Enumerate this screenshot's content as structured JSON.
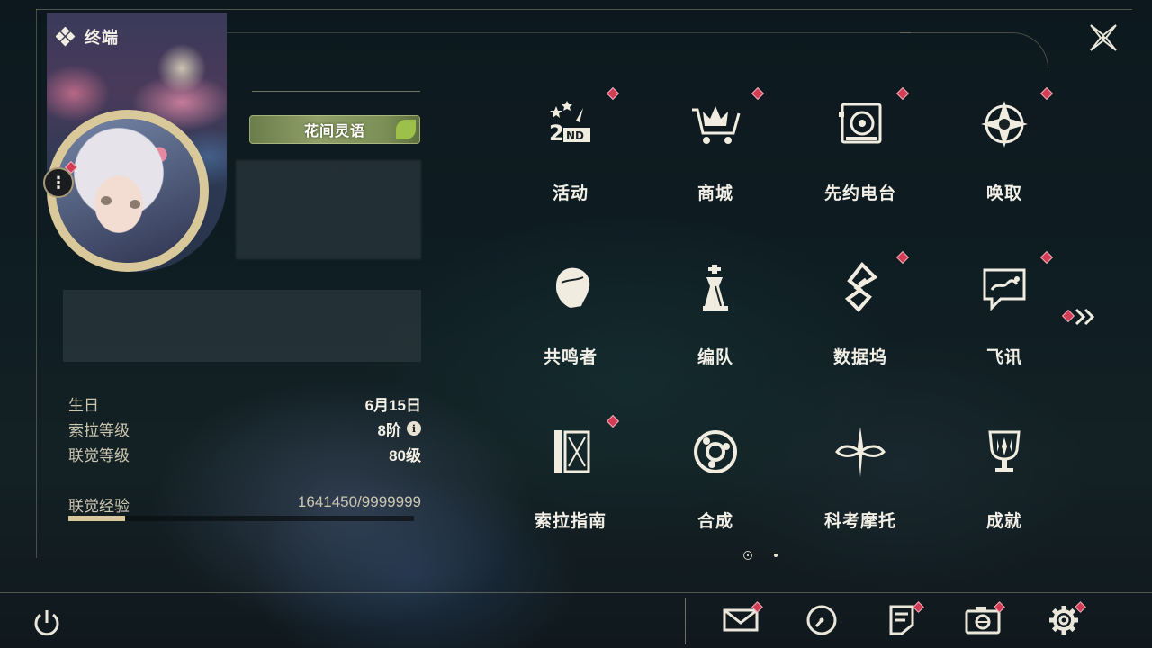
{
  "header": {
    "title": "终端",
    "icon": "diamond-cluster-icon"
  },
  "profile": {
    "title_badge": "花间灵语",
    "stats": [
      {
        "label": "生日",
        "value": "6月15日"
      },
      {
        "label": "索拉等级",
        "value": "8阶",
        "info_icon": "i"
      },
      {
        "label": "联觉等级",
        "value": "80级"
      }
    ],
    "exp": {
      "label": "联觉经验",
      "value": "1641450/9999999",
      "progress": 0.164
    }
  },
  "menu": [
    {
      "label": "活动",
      "icon": "event-2nd-anniversary-icon",
      "badge": true
    },
    {
      "label": "商城",
      "icon": "shop-crown-cart-icon",
      "badge": true
    },
    {
      "label": "先约电台",
      "icon": "pioneer-radio-icon",
      "badge": true
    },
    {
      "label": "唤取",
      "icon": "convene-compass-icon",
      "badge": true
    },
    {
      "label": "共鸣者",
      "icon": "resonator-head-icon",
      "badge": false
    },
    {
      "label": "编队",
      "icon": "team-chess-icon",
      "badge": false
    },
    {
      "label": "数据坞",
      "icon": "data-bank-icon",
      "badge": true
    },
    {
      "label": "飞讯",
      "icon": "message-chat-icon",
      "badge": true
    },
    {
      "label": "索拉指南",
      "icon": "solaris-guide-icon",
      "badge": true
    },
    {
      "label": "合成",
      "icon": "synthesis-icon",
      "badge": false
    },
    {
      "label": "科考摩托",
      "icon": "motorbike-icon",
      "badge": false
    },
    {
      "label": "成就",
      "icon": "achievement-trophy-icon",
      "badge": false
    }
  ],
  "bottom_bar": [
    {
      "name": "mail",
      "icon": "mail-icon",
      "badge": true
    },
    {
      "name": "clock",
      "icon": "clock-icon",
      "badge": false
    },
    {
      "name": "notes",
      "icon": "notes-icon",
      "badge": true
    },
    {
      "name": "camera",
      "icon": "camera-icon",
      "badge": true
    },
    {
      "name": "settings",
      "icon": "gear-icon",
      "badge": true
    }
  ],
  "colors": {
    "accent": "#d8c79a",
    "badge": "#d23c55",
    "text": "#f2efe6"
  }
}
